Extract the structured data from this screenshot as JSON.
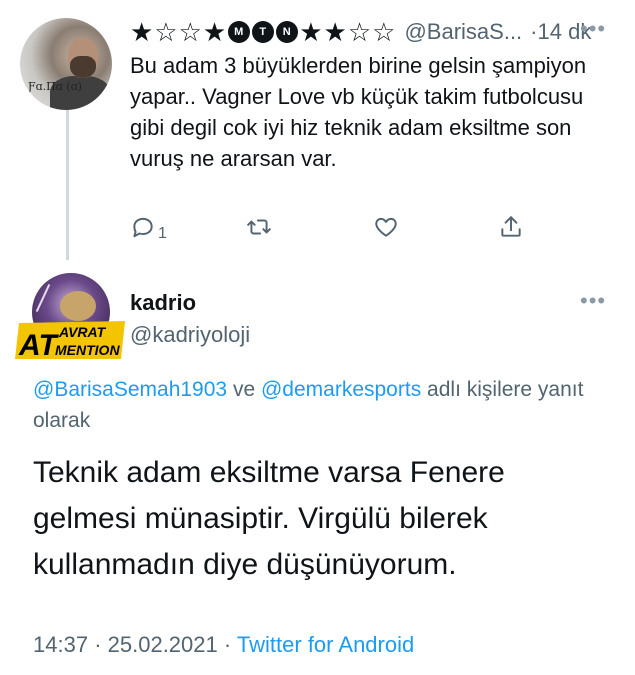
{
  "tweet1": {
    "display_name": "★☆☆★",
    "name_badges": [
      "M",
      "T",
      "N"
    ],
    "display_name_tail": "★★☆☆",
    "handle": "@BarisaS...",
    "time": "·14 dk",
    "text": "Bu adam 3 büyüklerden birine gelsin şampiyon yapar.. Vagner Love vb küçük takim futbolcusu gibi degil cok iyi hiz teknik adam eksiltme son vuruş ne ararsan var.",
    "avatar_tattoo": "Ƒɑ.Πɑ (ɑ)",
    "actions": {
      "reply_icon": "reply-icon",
      "reply_count": "1",
      "retweet_icon": "retweet-icon",
      "like_icon": "heart-icon",
      "share_icon": "share-icon"
    }
  },
  "tweet2": {
    "display_name": "kadrio",
    "handle": "@kadriyoloji",
    "badge_top": "AVRAT",
    "badge_left": "AT",
    "badge_bottom": "MENTION",
    "reply_mention_1": "@BarisaSemah1903",
    "reply_connector": "ve",
    "reply_mention_2": "@demarkesports",
    "reply_suffix": "adlı kişilere yanıt olarak",
    "text": "Teknik adam eksiltme varsa Fenere gelmesi münasiptir. Virgülü bilerek kullanmadın diye düşünüyorum.",
    "time": "14:37",
    "separator": "·",
    "date": "25.02.2021",
    "source": "Twitter for Android"
  },
  "icons": {
    "more": "•••"
  },
  "colors": {
    "accent": "#1d9bf0",
    "secondary_text": "#536471",
    "primary_text": "#0f1419",
    "thread_line": "#cfd9de"
  }
}
